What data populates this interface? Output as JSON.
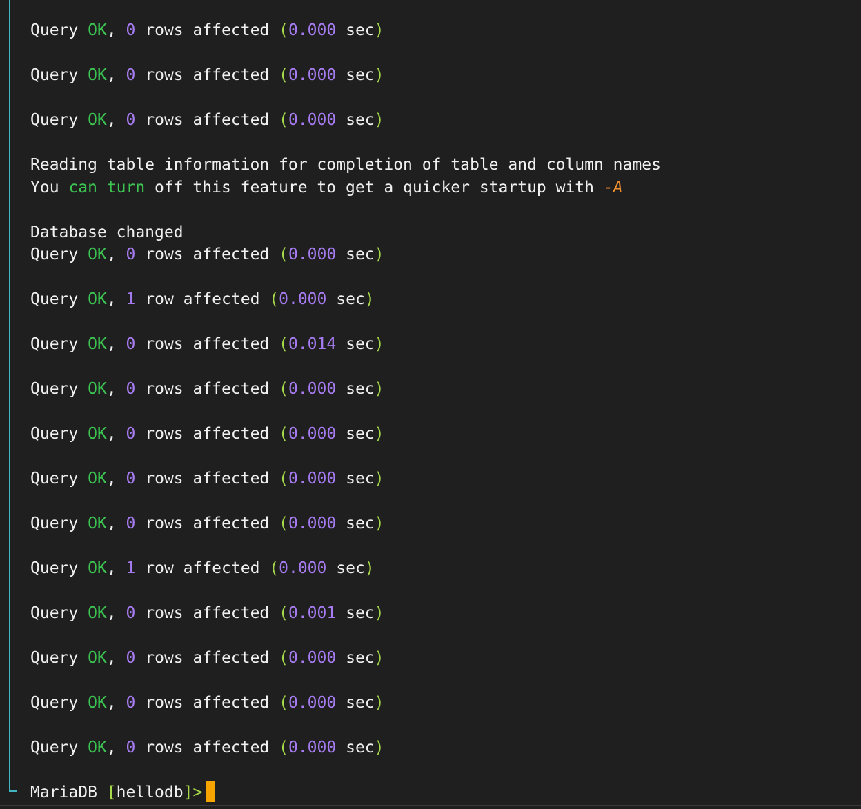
{
  "colors": {
    "background": "#1f1f1f",
    "text": "#f0f0f0",
    "ok": "#3cc552",
    "number": "#a77cf2",
    "paren": "#a6d94a",
    "flag": "#f0902e",
    "cursor": "#f5a400",
    "scope_bar": "#3fb6c2"
  },
  "terminal": {
    "query_lines_a": [
      {
        "prefix": "Query",
        "ok": "OK",
        "comma": ",",
        "count": "0",
        "rows": "rows affected",
        "open": "(",
        "time": "0.000",
        "unit": "sec",
        "close": ")"
      },
      {
        "prefix": "Query",
        "ok": "OK",
        "comma": ",",
        "count": "0",
        "rows": "rows affected",
        "open": "(",
        "time": "0.000",
        "unit": "sec",
        "close": ")"
      },
      {
        "prefix": "Query",
        "ok": "OK",
        "comma": ",",
        "count": "0",
        "rows": "rows affected",
        "open": "(",
        "time": "0.000",
        "unit": "sec",
        "close": ")"
      }
    ],
    "reading_line": "Reading table information for completion of table and column names",
    "you_line": {
      "p1": "You ",
      "kw1": "can",
      "p2": " ",
      "kw2": "turn",
      "p3": " off this feature to get a quicker startup with ",
      "flag": "-A"
    },
    "db_changed": "Database changed",
    "query_lines_b": [
      {
        "prefix": "Query",
        "ok": "OK",
        "comma": ",",
        "count": "0",
        "rows": "rows affected",
        "open": "(",
        "time": "0.000",
        "unit": "sec",
        "close": ")"
      },
      {
        "prefix": "Query",
        "ok": "OK",
        "comma": ",",
        "count": "1",
        "rows": "row affected",
        "open": "(",
        "time": "0.000",
        "unit": "sec",
        "close": ")"
      },
      {
        "prefix": "Query",
        "ok": "OK",
        "comma": ",",
        "count": "0",
        "rows": "rows affected",
        "open": "(",
        "time": "0.014",
        "unit": "sec",
        "close": ")"
      },
      {
        "prefix": "Query",
        "ok": "OK",
        "comma": ",",
        "count": "0",
        "rows": "rows affected",
        "open": "(",
        "time": "0.000",
        "unit": "sec",
        "close": ")"
      },
      {
        "prefix": "Query",
        "ok": "OK",
        "comma": ",",
        "count": "0",
        "rows": "rows affected",
        "open": "(",
        "time": "0.000",
        "unit": "sec",
        "close": ")"
      },
      {
        "prefix": "Query",
        "ok": "OK",
        "comma": ",",
        "count": "0",
        "rows": "rows affected",
        "open": "(",
        "time": "0.000",
        "unit": "sec",
        "close": ")"
      },
      {
        "prefix": "Query",
        "ok": "OK",
        "comma": ",",
        "count": "0",
        "rows": "rows affected",
        "open": "(",
        "time": "0.000",
        "unit": "sec",
        "close": ")"
      },
      {
        "prefix": "Query",
        "ok": "OK",
        "comma": ",",
        "count": "1",
        "rows": "row affected",
        "open": "(",
        "time": "0.000",
        "unit": "sec",
        "close": ")"
      },
      {
        "prefix": "Query",
        "ok": "OK",
        "comma": ",",
        "count": "0",
        "rows": "rows affected",
        "open": "(",
        "time": "0.001",
        "unit": "sec",
        "close": ")"
      },
      {
        "prefix": "Query",
        "ok": "OK",
        "comma": ",",
        "count": "0",
        "rows": "rows affected",
        "open": "(",
        "time": "0.000",
        "unit": "sec",
        "close": ")"
      },
      {
        "prefix": "Query",
        "ok": "OK",
        "comma": ",",
        "count": "0",
        "rows": "rows affected",
        "open": "(",
        "time": "0.000",
        "unit": "sec",
        "close": ")"
      },
      {
        "prefix": "Query",
        "ok": "OK",
        "comma": ",",
        "count": "0",
        "rows": "rows affected",
        "open": "(",
        "time": "0.000",
        "unit": "sec",
        "close": ")"
      }
    ],
    "prompt": {
      "name": "MariaDB",
      "open_bracket": "[",
      "db": "hellodb",
      "close_bracket": "]",
      "arrow": ">"
    }
  }
}
